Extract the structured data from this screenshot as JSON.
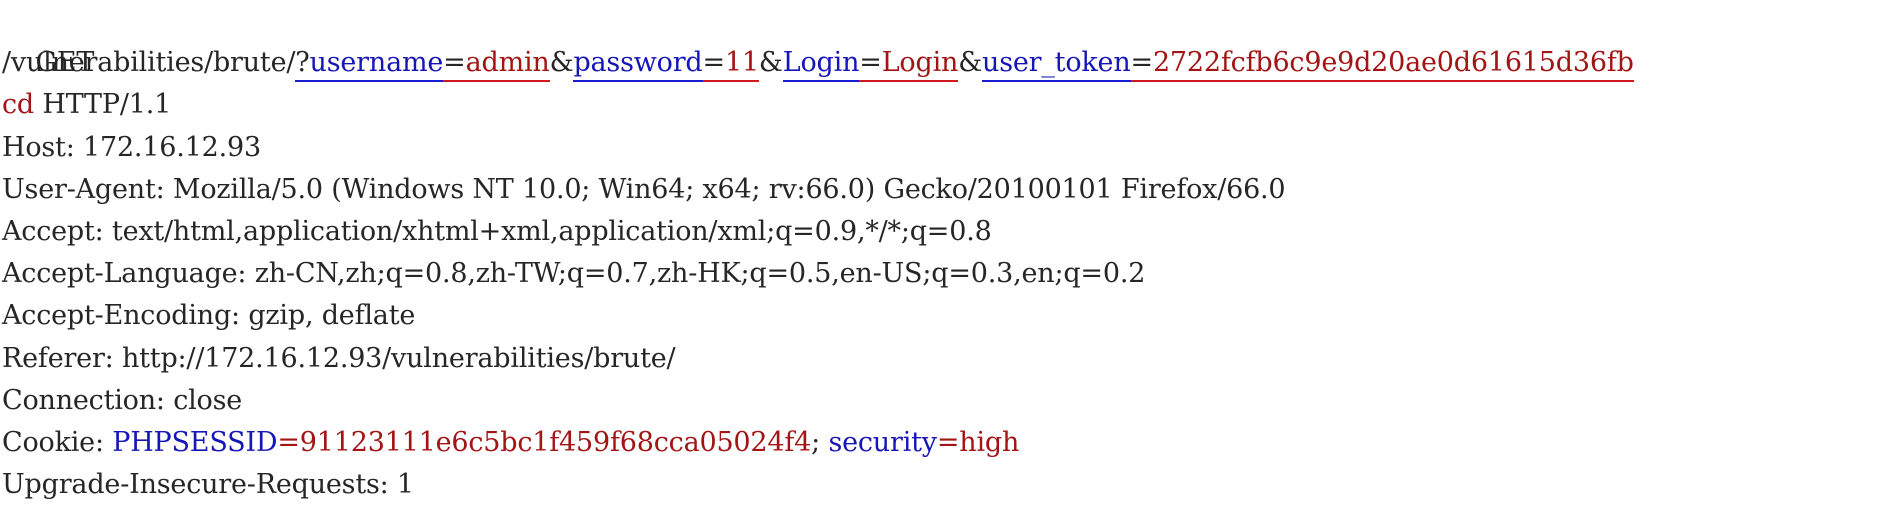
{
  "request": {
    "method": "GET",
    "path": "/vulnerabilities/brute/",
    "query_start": "?",
    "params": [
      {
        "key": "username",
        "value": "admin"
      },
      {
        "key": "password",
        "value": "11"
      },
      {
        "key": "Login",
        "value": "Login"
      },
      {
        "key": "user_token",
        "value": "2722fcfb6c9e9d20ae0d61615d36fb"
      }
    ],
    "token_continuation": "cd",
    "protocol": " HTTP/1.1",
    "amp": "&",
    "eq": "=",
    "headers": {
      "host": "Host: 172.16.12.93",
      "user_agent": "User-Agent: Mozilla/5.0 (Windows NT 10.0; Win64; x64; rv:66.0) Gecko/20100101 Firefox/66.0",
      "accept": "Accept: text/html,application/xhtml+xml,application/xml;q=0.9,*/*;q=0.8",
      "accept_language": "Accept-Language: zh-CN,zh;q=0.8,zh-TW;q=0.7,zh-HK;q=0.5,en-US;q=0.3,en;q=0.2",
      "accept_encoding": "Accept-Encoding: gzip, deflate",
      "referer": "Referer: http://172.16.12.93/vulnerabilities/brute/",
      "connection": "Connection: close",
      "cookie_label": "Cookie: ",
      "cookie_phpsessid_key": "PHPSESSID",
      "cookie_phpsessid_value": "91123111e6c5bc1f459f68cca05024f4",
      "cookie_sep": "; ",
      "cookie_security_key": "security",
      "cookie_security_value": "high",
      "upgrade": "Upgrade-Insecure-Requests: 1"
    }
  },
  "colors": {
    "key": "#1515b8",
    "value": "#a31515",
    "text": "#262626",
    "underline_blue": "#1a1ad0",
    "underline_red": "#d01a1a"
  }
}
